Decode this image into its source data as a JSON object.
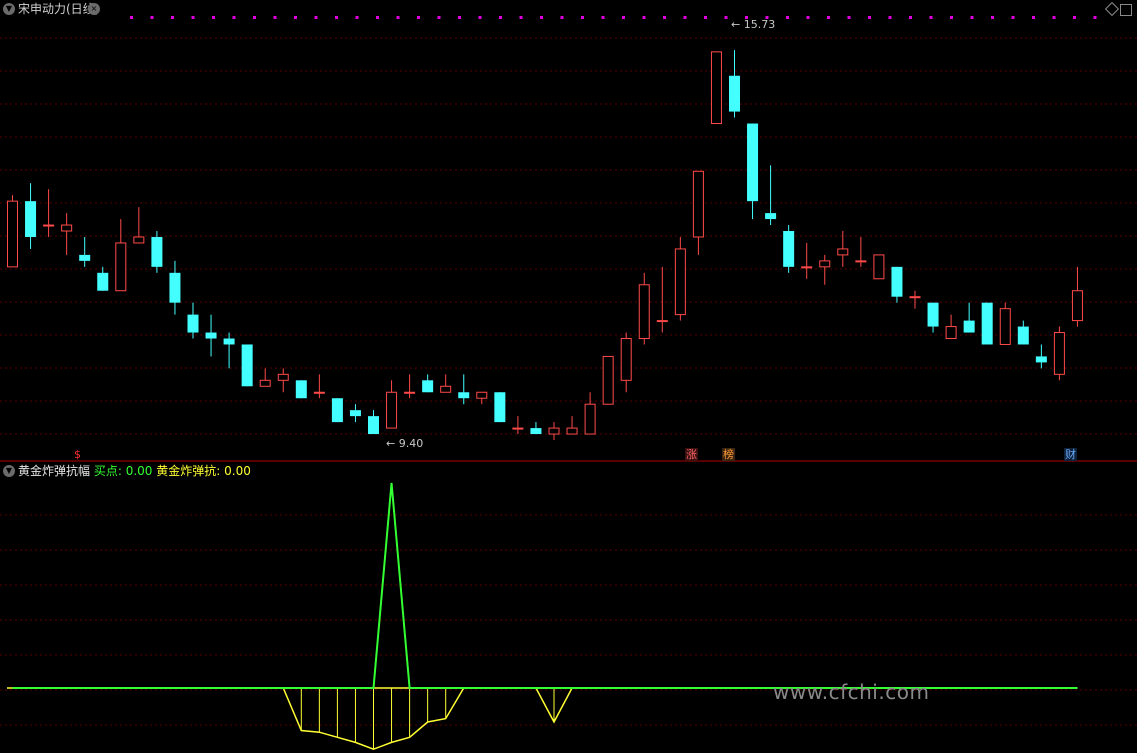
{
  "main_panel": {
    "title": "宋申动力(日线)",
    "high_label": "15.73",
    "low_label": "9.40",
    "tags": {
      "s_marker": "$",
      "zhang": "涨",
      "bang": "榜",
      "cai": "财"
    }
  },
  "sub_panel": {
    "title": "黄金炸弹抗幅",
    "buy_label": "买点:",
    "buy_value": "0.00",
    "bomb_label": "黄金炸弹抗:",
    "bomb_value": "0.00"
  },
  "watermark": "www.cfchi.com",
  "colors": {
    "up": "#ff4a4a",
    "down": "#44ffff",
    "grid": "#5a0000",
    "separator": "#b00000",
    "yellow": "#ffff33",
    "green": "#33ff33",
    "marker": "#e000e0"
  },
  "chart_data": {
    "type": "candlestick",
    "ylim": [
      9.1,
      16.2
    ],
    "high_annotation": 15.73,
    "low_annotation": 9.4,
    "candles": [
      [
        12.1,
        13.2,
        13.3,
        12.1
      ],
      [
        13.2,
        12.6,
        13.5,
        12.4
      ],
      [
        12.8,
        12.8,
        13.4,
        12.6
      ],
      [
        12.7,
        12.8,
        13.0,
        12.3
      ],
      [
        12.3,
        12.2,
        12.6,
        12.1
      ],
      [
        12.0,
        11.7,
        12.1,
        11.7
      ],
      [
        11.7,
        12.5,
        12.9,
        11.7
      ],
      [
        12.5,
        12.6,
        13.1,
        12.5
      ],
      [
        12.6,
        12.1,
        12.7,
        12.0
      ],
      [
        12.0,
        11.5,
        12.2,
        11.3
      ],
      [
        11.3,
        11.0,
        11.5,
        10.9
      ],
      [
        11.0,
        10.9,
        11.3,
        10.6
      ],
      [
        10.9,
        10.8,
        11.0,
        10.4
      ],
      [
        10.8,
        10.1,
        10.8,
        10.1
      ],
      [
        10.1,
        10.2,
        10.4,
        10.1
      ],
      [
        10.2,
        10.3,
        10.4,
        10.0
      ],
      [
        10.2,
        9.9,
        10.2,
        9.9
      ],
      [
        10.0,
        10.0,
        10.3,
        9.9
      ],
      [
        9.9,
        9.5,
        9.9,
        9.5
      ],
      [
        9.7,
        9.6,
        9.8,
        9.5
      ],
      [
        9.6,
        9.3,
        9.7,
        9.3
      ],
      [
        9.4,
        10.0,
        10.2,
        9.4
      ],
      [
        10.0,
        10.0,
        10.3,
        9.9
      ],
      [
        10.2,
        10.0,
        10.3,
        10.0
      ],
      [
        10.0,
        10.1,
        10.3,
        10.0
      ],
      [
        10.0,
        9.9,
        10.3,
        9.8
      ],
      [
        9.9,
        10.0,
        10.0,
        9.8
      ],
      [
        10.0,
        9.5,
        10.0,
        9.5
      ],
      [
        9.4,
        9.4,
        9.6,
        9.3
      ],
      [
        9.4,
        9.3,
        9.5,
        9.3
      ],
      [
        9.3,
        9.4,
        9.5,
        9.2
      ],
      [
        9.3,
        9.4,
        9.6,
        9.3
      ],
      [
        9.3,
        9.8,
        10.0,
        9.3
      ],
      [
        9.8,
        10.6,
        10.6,
        9.8
      ],
      [
        10.2,
        10.9,
        11.0,
        10.0
      ],
      [
        10.9,
        11.8,
        12.0,
        10.8
      ],
      [
        11.2,
        11.2,
        12.1,
        11.0
      ],
      [
        11.3,
        12.4,
        12.6,
        11.2
      ],
      [
        12.6,
        13.7,
        13.7,
        12.3
      ],
      [
        14.5,
        15.7,
        15.7,
        14.5
      ],
      [
        15.3,
        14.7,
        15.73,
        14.6
      ],
      [
        14.5,
        13.2,
        14.5,
        12.9
      ],
      [
        13.0,
        12.9,
        13.8,
        12.8
      ],
      [
        12.7,
        12.1,
        12.8,
        12.0
      ],
      [
        12.1,
        12.1,
        12.5,
        11.9
      ],
      [
        12.1,
        12.2,
        12.3,
        11.8
      ],
      [
        12.3,
        12.4,
        12.7,
        12.1
      ],
      [
        12.2,
        12.2,
        12.6,
        12.1
      ],
      [
        11.9,
        12.3,
        12.3,
        11.9
      ],
      [
        12.1,
        11.6,
        12.1,
        11.5
      ],
      [
        11.6,
        11.6,
        11.7,
        11.4
      ],
      [
        11.5,
        11.1,
        11.5,
        11.0
      ],
      [
        10.9,
        11.1,
        11.3,
        10.9
      ],
      [
        11.2,
        11.0,
        11.5,
        11.0
      ],
      [
        11.5,
        10.8,
        11.5,
        10.8
      ],
      [
        10.8,
        11.4,
        11.5,
        10.8
      ],
      [
        11.1,
        10.8,
        11.2,
        10.8
      ],
      [
        10.6,
        10.5,
        10.8,
        10.4
      ],
      [
        10.3,
        11.0,
        11.1,
        10.2
      ],
      [
        11.2,
        11.7,
        12.1,
        11.1
      ]
    ],
    "indicator": {
      "series": [
        {
          "name": "买点",
          "values": [
            0,
            0,
            0,
            0,
            0,
            0,
            0,
            0,
            0,
            0,
            0,
            0,
            0,
            0,
            0,
            0,
            0,
            0,
            0,
            0,
            0,
            1,
            0,
            0,
            0,
            0,
            0,
            0,
            0,
            0,
            0,
            0,
            0,
            0,
            0,
            0,
            0,
            0,
            0,
            0,
            0,
            0,
            0,
            0,
            0,
            0,
            0,
            0,
            0,
            0,
            0,
            0,
            0,
            0,
            0,
            0,
            0,
            0,
            0,
            0
          ]
        },
        {
          "name": "黄金炸弹抗",
          "values": [
            0,
            0,
            0,
            0,
            0,
            0,
            0,
            0,
            0,
            0,
            0,
            0,
            0,
            0,
            0,
            0,
            -0.25,
            -0.26,
            -0.29,
            -0.32,
            -0.36,
            -0.32,
            -0.29,
            -0.2,
            -0.18,
            0,
            0,
            0,
            0,
            0,
            -0.2,
            0,
            0,
            0,
            0,
            0,
            0,
            0,
            0,
            0,
            0,
            0,
            0,
            0,
            0,
            0,
            0,
            0,
            0,
            0,
            0,
            0,
            0,
            0,
            0,
            0,
            0,
            0,
            0,
            0
          ]
        }
      ]
    }
  }
}
